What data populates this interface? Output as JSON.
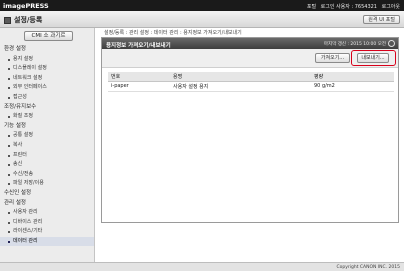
{
  "header": {
    "logo": "imagePRESS",
    "links": [
      "포털",
      "로그인 사용자 : 7654321",
      "로그아웃"
    ]
  },
  "subheader": {
    "app_title": "설정/등록",
    "portal_button": "원격 UI 포털"
  },
  "sidebar": {
    "cmi_button": "CMI 소 과기르",
    "sections": [
      {
        "label": "환경 설정",
        "items": [
          "용지 설정",
          "디스플레이 설정",
          "네트워크 설정",
          "외부 인터페이스",
          "접근성"
        ]
      },
      {
        "label": "조정/유지보수",
        "items": [
          "화질 조정"
        ]
      },
      {
        "label": "기능 설정",
        "items": [
          "공통 설정",
          "복사",
          "프린터",
          "송신",
          "수신/전송",
          "파일 저장/이용"
        ]
      },
      {
        "label": "수신인 설정",
        "items": []
      },
      {
        "label": "관리 설정",
        "items": [
          "사용자 관리",
          "디바이스 관리",
          "라이센스/기타",
          "데이터 관리"
        ]
      }
    ],
    "active_item": "데이터 관리"
  },
  "breadcrumb": "설정/등록 : 관리 설정 : 데이터 관리 : 용지정보 가져오기/내보내기",
  "panel": {
    "title": "용지정보 가져오기/내보내기",
    "status": "마지막 갱신 : 2015 10:00 오전",
    "import_button": "가져오기...",
    "export_button": "내보내기...",
    "table": {
      "headers": [
        "번호",
        "용명",
        "평량"
      ],
      "rows": [
        [
          "i-paper",
          "사용자 설정 용지",
          "90 g/m2"
        ]
      ]
    }
  },
  "footer": {
    "copyright": "Copyright CANON INC. 2015"
  },
  "colors": {
    "highlight": "#d8001a",
    "topbar": "#1a1a1a"
  }
}
